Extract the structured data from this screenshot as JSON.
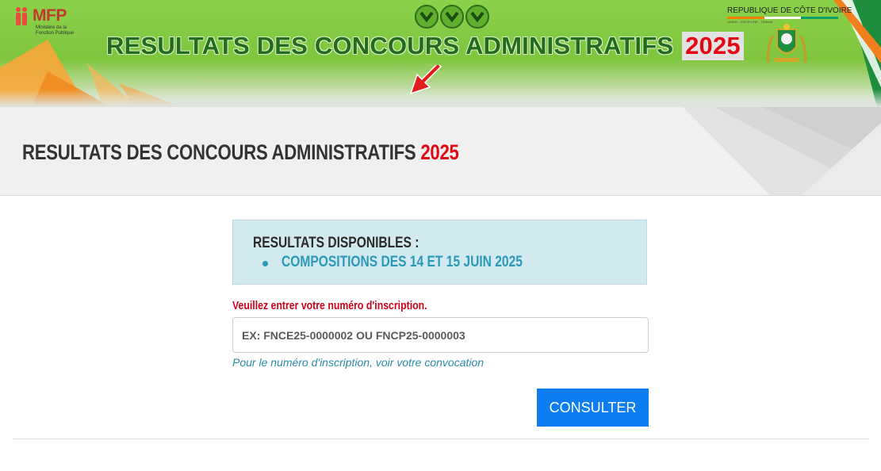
{
  "banner": {
    "logo_text": "MFP",
    "logo_subtitle": "Ministère de la Fonction Publique",
    "title": "RESULTATS DES CONCOURS ADMINISTRATIFS",
    "year": "2025",
    "republic": "REPUBLIQUE DE CÔTE D'IVOIRE",
    "motto": "UNION - DISCIPLINE - TRAVAIL",
    "flag_colors": [
      "#f77f00",
      "#ffffff",
      "#009e60"
    ]
  },
  "header": {
    "title": "RESULTATS DES CONCOURS ADMINISTRATIFS",
    "year": "2025"
  },
  "info": {
    "title": "RESULTATS DISPONIBLES :",
    "items": [
      "COMPOSITIONS DES 14 ET 15 JUIN 2025"
    ]
  },
  "form": {
    "label": "Veuillez entrer votre numéro d'inscription.",
    "placeholder": "EX: FNCE25-0000002 OU FNCP25-0000003",
    "value": "",
    "help": "Pour le numéro d'inscription, voir votre convocation",
    "submit_label": "CONSULTER"
  },
  "colors": {
    "accent_red": "#e30613",
    "button_blue": "#0d7ef2",
    "info_bg": "#d1e9ef",
    "info_text": "#2a99b8",
    "banner_green": "#7fc53d"
  }
}
